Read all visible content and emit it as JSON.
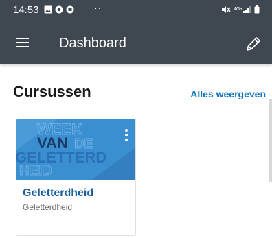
{
  "status_bar": {
    "time": "14:53",
    "dots": "··",
    "network_label": "4G+",
    "icons_left": [
      "gallery-icon",
      "app-icon",
      "app-icon"
    ],
    "icons_right": [
      "mute-icon",
      "signal-icon",
      "battery-icon"
    ]
  },
  "app_bar": {
    "title": "Dashboard",
    "menu_icon": "hamburger-menu-icon",
    "edit_icon": "pencil-icon"
  },
  "section": {
    "title": "Cursussen",
    "view_all_label": "Alles weergeven"
  },
  "courses": [
    {
      "title": "Geletterdheid",
      "subtitle": "Geletterdheid",
      "image_text_lines": [
        "WEEK",
        "VAN",
        "DE",
        "GELETTERD",
        "HEID"
      ],
      "menu_icon": "kebab-menu-icon"
    }
  ],
  "colors": {
    "header_bg": "#3f4750",
    "accent_link": "#1177bb",
    "course_title": "#1a5f9e",
    "card_image_bg": "#3a8fd0"
  }
}
